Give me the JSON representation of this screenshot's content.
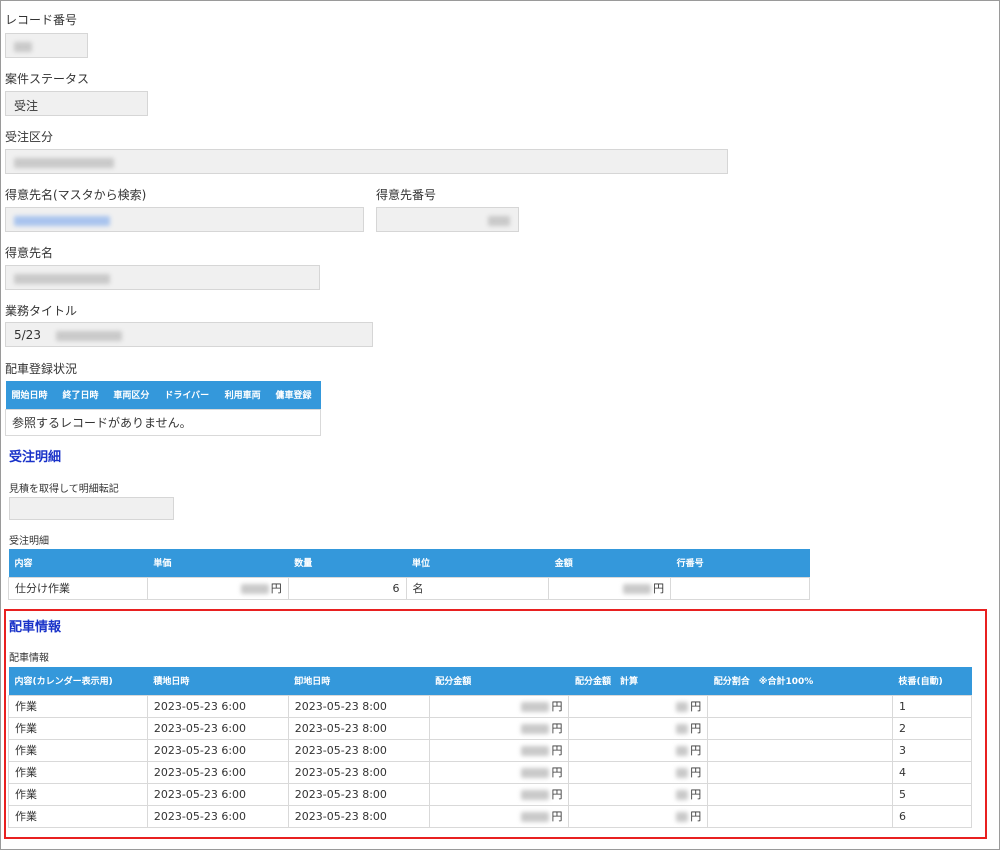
{
  "fields": {
    "record_no": {
      "label": "レコード番号"
    },
    "status": {
      "label": "案件ステータス",
      "value": "受注"
    },
    "order_type": {
      "label": "受注区分"
    },
    "customer_search": {
      "label": "得意先名(マスタから検索)"
    },
    "customer_no": {
      "label": "得意先番号"
    },
    "customer_name": {
      "label": "得意先名"
    },
    "job_title": {
      "label": "業務タイトル",
      "value": "5/23"
    },
    "dispatch_status": {
      "label": "配車登録状況"
    }
  },
  "dispatch_table": {
    "headers": [
      "開始日時",
      "終了日時",
      "車両区分",
      "ドライバー",
      "利用車両",
      "傭車登録"
    ],
    "empty_text": "参照するレコードがありません。"
  },
  "order_section": {
    "title": "受注明細",
    "quote_label": "見積を取得して明細転記",
    "detail_label": "受注明細",
    "headers": [
      "内容",
      "単価",
      "数量",
      "単位",
      "金額",
      "行番号"
    ],
    "rows": [
      {
        "content": "仕分け作業",
        "unit_suffix": "円",
        "qty": "6",
        "unit": "名",
        "amount_suffix": "円",
        "line": ""
      }
    ]
  },
  "dispatch_info": {
    "title": "配車情報",
    "sub_label": "配車情報",
    "headers": [
      "内容(カレンダー表示用)",
      "積地日時",
      "卸地日時",
      "配分金額",
      "配分金額　計算",
      "配分割合　※合計100%",
      "枝番(自動)"
    ],
    "rows": [
      {
        "content": "作業",
        "load": "2023-05-23 6:00",
        "unload": "2023-05-23 8:00",
        "yen1": "円",
        "yen2": "円",
        "ratio": "",
        "branch": "1"
      },
      {
        "content": "作業",
        "load": "2023-05-23 6:00",
        "unload": "2023-05-23 8:00",
        "yen1": "円",
        "yen2": "円",
        "ratio": "",
        "branch": "2"
      },
      {
        "content": "作業",
        "load": "2023-05-23 6:00",
        "unload": "2023-05-23 8:00",
        "yen1": "円",
        "yen2": "円",
        "ratio": "",
        "branch": "3"
      },
      {
        "content": "作業",
        "load": "2023-05-23 6:00",
        "unload": "2023-05-23 8:00",
        "yen1": "円",
        "yen2": "円",
        "ratio": "",
        "branch": "4"
      },
      {
        "content": "作業",
        "load": "2023-05-23 6:00",
        "unload": "2023-05-23 8:00",
        "yen1": "円",
        "yen2": "円",
        "ratio": "",
        "branch": "5"
      },
      {
        "content": "作業",
        "load": "2023-05-23 6:00",
        "unload": "2023-05-23 8:00",
        "yen1": "円",
        "yen2": "円",
        "ratio": "",
        "branch": "6"
      }
    ]
  },
  "colors": {
    "header_bg": "#3498db",
    "section_title": "#1a33c9",
    "highlight_border": "#e82020",
    "field_bg": "#f0f0f0"
  }
}
